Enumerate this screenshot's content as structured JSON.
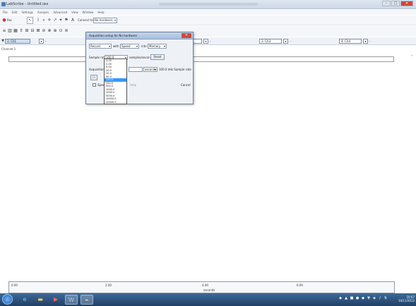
{
  "window": {
    "title": "LabScribe - Untitled.iwx",
    "close_glyph": "✕",
    "minimize_glyph": "–",
    "maximize_glyph": "□"
  },
  "menu": [
    "File",
    "Edit",
    "Settings",
    "Analysis",
    "Advanced",
    "View",
    "Window",
    "Help"
  ],
  "toolbar": {
    "record_label": "Rec",
    "connect_label": "Connect to",
    "connect_value": "No hardware"
  },
  "channels": [
    {
      "label": "1: Ch1",
      "selected": true
    },
    {
      "label": "2: Ch2"
    },
    {
      "label": "3: Ch3"
    },
    {
      "label": "4: Ch4"
    },
    {
      "label": "5: Ch5"
    }
  ],
  "channel_row_label": "Channel 1",
  "dialog": {
    "title": "Acquisition setup for No hardware",
    "device_value": "Record",
    "with_label": "with",
    "type_value": "Speed",
    "into_label": "into",
    "file_value": "Memory",
    "sample_rate_label": "Sample rate",
    "sample_rate_value": "100.0",
    "samples_label": "samples/second",
    "reset_label": "Reset",
    "acq_label": "Acquisition",
    "acq_unit": "seconds",
    "acq_note": "100.0 kHz Sample rate",
    "acq_value": "",
    "ok_label": "OK",
    "speed_label": "Speed",
    "help_label": "Help",
    "cancel_label": "Cancel"
  },
  "sample_rate_options": [
    "1.00",
    "2.00",
    "5.00",
    "10.0",
    "20.0",
    "50.0",
    "100.0",
    "200.0",
    "500.0",
    "1000.0",
    "2000.0",
    "5000.0",
    "10000.0",
    "20000.0",
    "40000.0",
    "100000.0"
  ],
  "selected_rate_index": 6,
  "xaxis": {
    "ticks": [
      "0.00",
      "2.00",
      "4.00",
      "6.00"
    ],
    "label": "seconds"
  },
  "taskbar": {
    "time": "10:07",
    "date": "10/11/2012"
  },
  "icons": {
    "start": "windows-start-icon",
    "ie": "internet-explorer-icon",
    "explorer": "folder-icon"
  }
}
